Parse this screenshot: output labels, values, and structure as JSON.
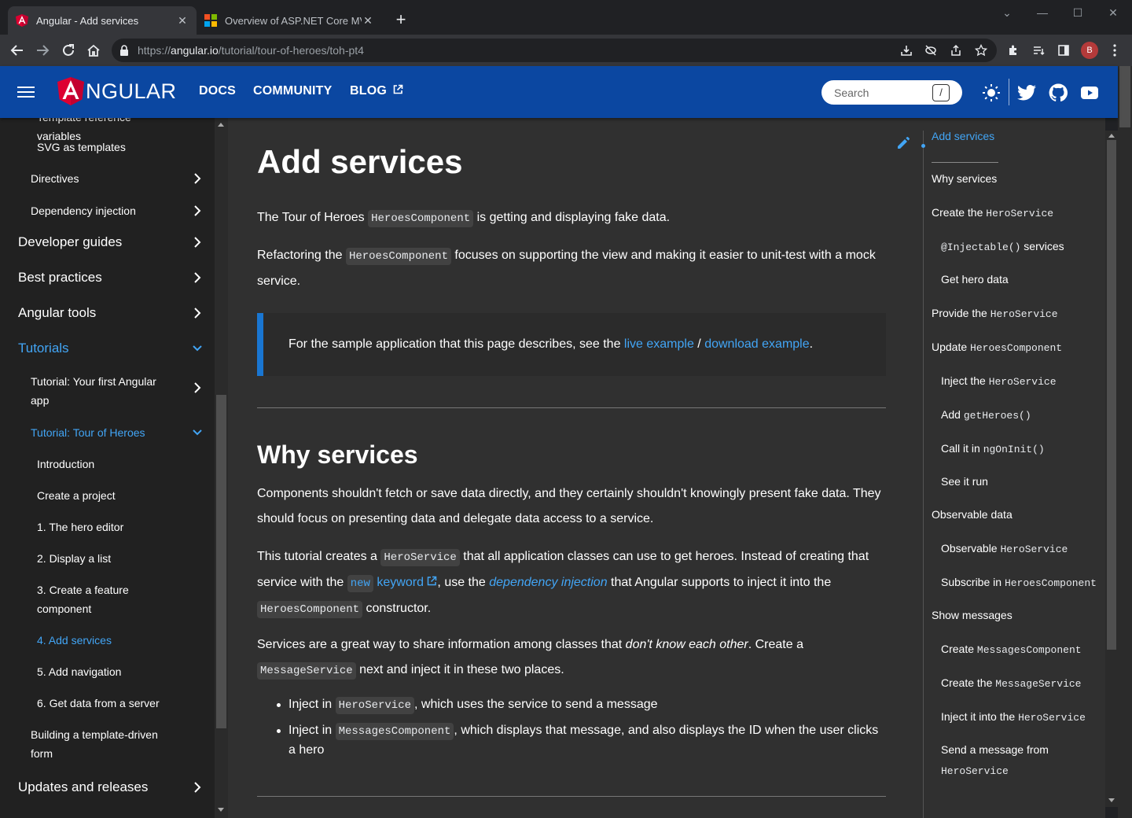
{
  "browser": {
    "tabs": [
      {
        "title": "Angular - Add services",
        "favicon": "angular-icon"
      },
      {
        "title": "Overview of ASP.NET Core MVC |",
        "favicon": "microsoft-icon"
      }
    ],
    "url_prefix": "https://",
    "url_host": "angular.io",
    "url_path": "/tutorial/tour-of-heroes/toh-pt4",
    "profile_initial": "B"
  },
  "header": {
    "logo_text": "NGULAR",
    "logo_letter": "A",
    "nav": [
      "DOCS",
      "COMMUNITY",
      "BLOG"
    ],
    "search_placeholder": "Search",
    "search_shortcut": "/"
  },
  "sidenav": [
    {
      "label": "Template reference variables",
      "level": 3
    },
    {
      "label": "SVG as templates",
      "level": 3
    },
    {
      "label": "Directives",
      "level": 2,
      "chevron": "right"
    },
    {
      "label": "Dependency injection",
      "level": 2,
      "chevron": "right"
    },
    {
      "label": "Developer guides",
      "level": 1,
      "chevron": "right"
    },
    {
      "label": "Best practices",
      "level": 1,
      "chevron": "right"
    },
    {
      "label": "Angular tools",
      "level": 1,
      "chevron": "right"
    },
    {
      "label": "Tutorials",
      "level": 1,
      "chevron": "down",
      "active": true
    },
    {
      "label": "Tutorial: Your first Angular app",
      "level": 2,
      "chevron": "right"
    },
    {
      "label": "Tutorial: Tour of Heroes",
      "level": 2,
      "chevron": "down",
      "active": true
    },
    {
      "label": "Introduction",
      "level": 3
    },
    {
      "label": "Create a project",
      "level": 3
    },
    {
      "label": "1. The hero editor",
      "level": 3
    },
    {
      "label": "2. Display a list",
      "level": 3
    },
    {
      "label": "3. Create a feature component",
      "level": 3
    },
    {
      "label": "4. Add services",
      "level": 3,
      "active": true
    },
    {
      "label": "5. Add navigation",
      "level": 3
    },
    {
      "label": "6. Get data from a server",
      "level": 3
    },
    {
      "label": "Building a template-driven form",
      "level": 2
    },
    {
      "label": "Updates and releases",
      "level": 1,
      "chevron": "right"
    }
  ],
  "article": {
    "title": "Add services",
    "intro1": {
      "a": "The Tour of Heroes ",
      "code": "HeroesComponent",
      "b": " is getting and displaying fake data."
    },
    "intro2": {
      "a": "Refactoring the ",
      "code": "HeroesComponent",
      "b": " focuses on supporting the view and making it easier to unit-test with a mock service."
    },
    "callout": {
      "a": "For the sample application that this page describes, see the ",
      "link1": "live example",
      "sep": " / ",
      "link2": "download example",
      "b": "."
    },
    "why_title": "Why services",
    "why1": "Components shouldn't fetch or save data directly, and they certainly shouldn't knowingly present fake data. They should focus on presenting data and delegate data access to a service.",
    "why2": {
      "a": "This tutorial creates a ",
      "code1": "HeroService",
      "b": " that all application classes can use to get heroes. Instead of creating that service with the ",
      "code2": "new",
      "kw": " keyword",
      "c": ", use the ",
      "di": "dependency injection",
      "d": " that Angular supports to inject it into the ",
      "code3": "HeroesComponent",
      "e": " constructor."
    },
    "why3": {
      "a": "Services are a great way to share information among classes that ",
      "em": "don't know each other",
      "b": ". Create a ",
      "code": "MessageService",
      "c": " next and inject it in these two places."
    },
    "bullets": [
      {
        "a": "Inject in ",
        "code": "HeroService",
        "b": ", which uses the service to send a message"
      },
      {
        "a": "Inject in ",
        "code": "MessagesComponent",
        "b": ", which displays that message, and also displays the ID when the user clicks a hero"
      }
    ]
  },
  "toc": [
    {
      "text": "Add services",
      "level": 1,
      "active": true
    },
    {
      "text": "Why services",
      "level": 1
    },
    {
      "text": "Create the ",
      "code": "HeroService",
      "level": 1
    },
    {
      "code": "@Injectable()",
      "text": " services",
      "level": 2,
      "code_first": true
    },
    {
      "text": "Get hero data",
      "level": 2
    },
    {
      "text": "Provide the ",
      "code": "HeroService",
      "level": 1
    },
    {
      "text": "Update ",
      "code": "HeroesComponent",
      "level": 1
    },
    {
      "text": "Inject the ",
      "code": "HeroService",
      "level": 2
    },
    {
      "text": "Add ",
      "code": "getHeroes()",
      "level": 2
    },
    {
      "text": "Call it in ",
      "code": "ngOnInit()",
      "level": 2
    },
    {
      "text": "See it run",
      "level": 2
    },
    {
      "text": "Observable data",
      "level": 1
    },
    {
      "text": "Observable ",
      "code": "HeroService",
      "level": 2
    },
    {
      "text": "Subscribe in ",
      "code": "HeroesComponent",
      "level": 2
    },
    {
      "text": "Show messages",
      "level": 1
    },
    {
      "text": "Create ",
      "code": "MessagesComponent",
      "level": 2
    },
    {
      "text": "Create the ",
      "code": "MessageService",
      "level": 2
    },
    {
      "text": "Inject it into the ",
      "code": "HeroService",
      "level": 2
    },
    {
      "text": "Send a message from",
      "code2": "HeroService",
      "level": 2
    }
  ],
  "colors": {
    "header": "#0b47a1",
    "accent": "#42a5f5",
    "bg": "#303030",
    "sidenav": "#212121"
  }
}
